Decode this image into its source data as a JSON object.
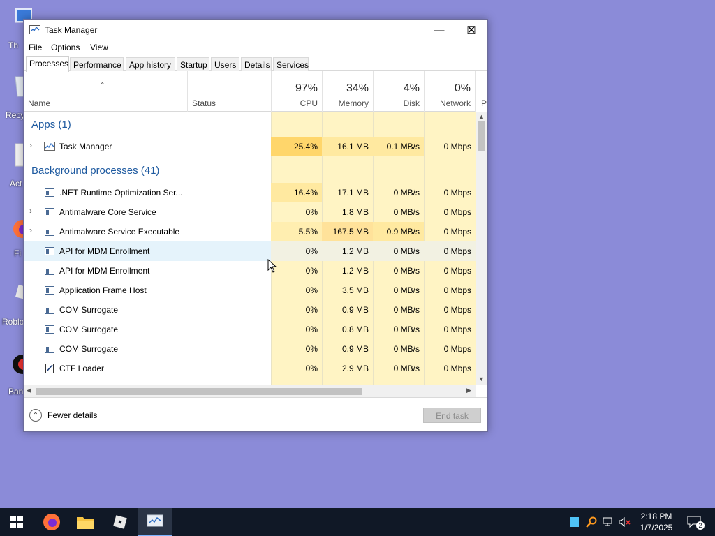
{
  "desktop": {
    "icons": [
      {
        "label": "Th",
        "icon": "this-pc-icon"
      },
      {
        "label": "Recy",
        "icon": "recycle-bin-icon"
      },
      {
        "label": "Act",
        "icon": "document-icon"
      },
      {
        "label": "Fi",
        "icon": "firefox-icon"
      },
      {
        "label": "Roblo",
        "icon": "roblox-icon"
      },
      {
        "label": "Ban",
        "icon": "bandicam-icon"
      }
    ]
  },
  "window": {
    "title": "Task Manager",
    "controls": {
      "minimize": "—",
      "maximize": "☐",
      "close": "✕"
    }
  },
  "menu": {
    "file": "File",
    "options": "Options",
    "view": "View"
  },
  "tabs": [
    "Processes",
    "Performance",
    "App history",
    "Startup",
    "Users",
    "Details",
    "Services"
  ],
  "columns": {
    "name": "Name",
    "status": "Status",
    "cpu": {
      "pct": "97%",
      "label": "CPU"
    },
    "memory": {
      "pct": "34%",
      "label": "Memory"
    },
    "disk": {
      "pct": "4%",
      "label": "Disk"
    },
    "network": {
      "pct": "0%",
      "label": "Network"
    },
    "power_partial": "P"
  },
  "groups": {
    "apps": "Apps (1)",
    "background": "Background processes (41)"
  },
  "apps": [
    {
      "name": "Task Manager",
      "cpu": "25.4%",
      "memory": "16.1 MB",
      "disk": "0.1 MB/s",
      "network": "0 Mbps"
    }
  ],
  "background": [
    {
      "name": ".NET Runtime Optimization Ser...",
      "cpu": "16.4%",
      "memory": "17.1 MB",
      "disk": "0 MB/s",
      "network": "0 Mbps"
    },
    {
      "name": "Antimalware Core Service",
      "cpu": "0%",
      "memory": "1.8 MB",
      "disk": "0 MB/s",
      "network": "0 Mbps"
    },
    {
      "name": "Antimalware Service Executable",
      "cpu": "5.5%",
      "memory": "167.5 MB",
      "disk": "0.9 MB/s",
      "network": "0 Mbps"
    },
    {
      "name": "API for MDM Enrollment",
      "cpu": "0%",
      "memory": "1.2 MB",
      "disk": "0 MB/s",
      "network": "0 Mbps"
    },
    {
      "name": "API for MDM Enrollment",
      "cpu": "0%",
      "memory": "1.2 MB",
      "disk": "0 MB/s",
      "network": "0 Mbps"
    },
    {
      "name": "Application Frame Host",
      "cpu": "0%",
      "memory": "3.5 MB",
      "disk": "0 MB/s",
      "network": "0 Mbps"
    },
    {
      "name": "COM Surrogate",
      "cpu": "0%",
      "memory": "0.9 MB",
      "disk": "0 MB/s",
      "network": "0 Mbps"
    },
    {
      "name": "COM Surrogate",
      "cpu": "0%",
      "memory": "0.8 MB",
      "disk": "0 MB/s",
      "network": "0 Mbps"
    },
    {
      "name": "COM Surrogate",
      "cpu": "0%",
      "memory": "0.9 MB",
      "disk": "0 MB/s",
      "network": "0 Mbps"
    },
    {
      "name": "CTF Loader",
      "cpu": "0%",
      "memory": "2.9 MB",
      "disk": "0 MB/s",
      "network": "0 Mbps"
    }
  ],
  "footer": {
    "fewer_details": "Fewer details",
    "end_task": "End task"
  },
  "taskbar": {
    "apps": [
      "start-icon",
      "firefox-icon",
      "file-explorer-icon",
      "roblox-icon",
      "task-manager-icon"
    ],
    "time": "2:18 PM",
    "date": "1/7/2025",
    "notifications": "2"
  },
  "colors": {
    "desktop": "#8b8bd8",
    "heat_light": "#fff4c4",
    "heat_mid": "#ffe9a0",
    "heat_high": "#ffd66b",
    "group_title": "#1e5aa0",
    "taskbar": "#101826"
  }
}
